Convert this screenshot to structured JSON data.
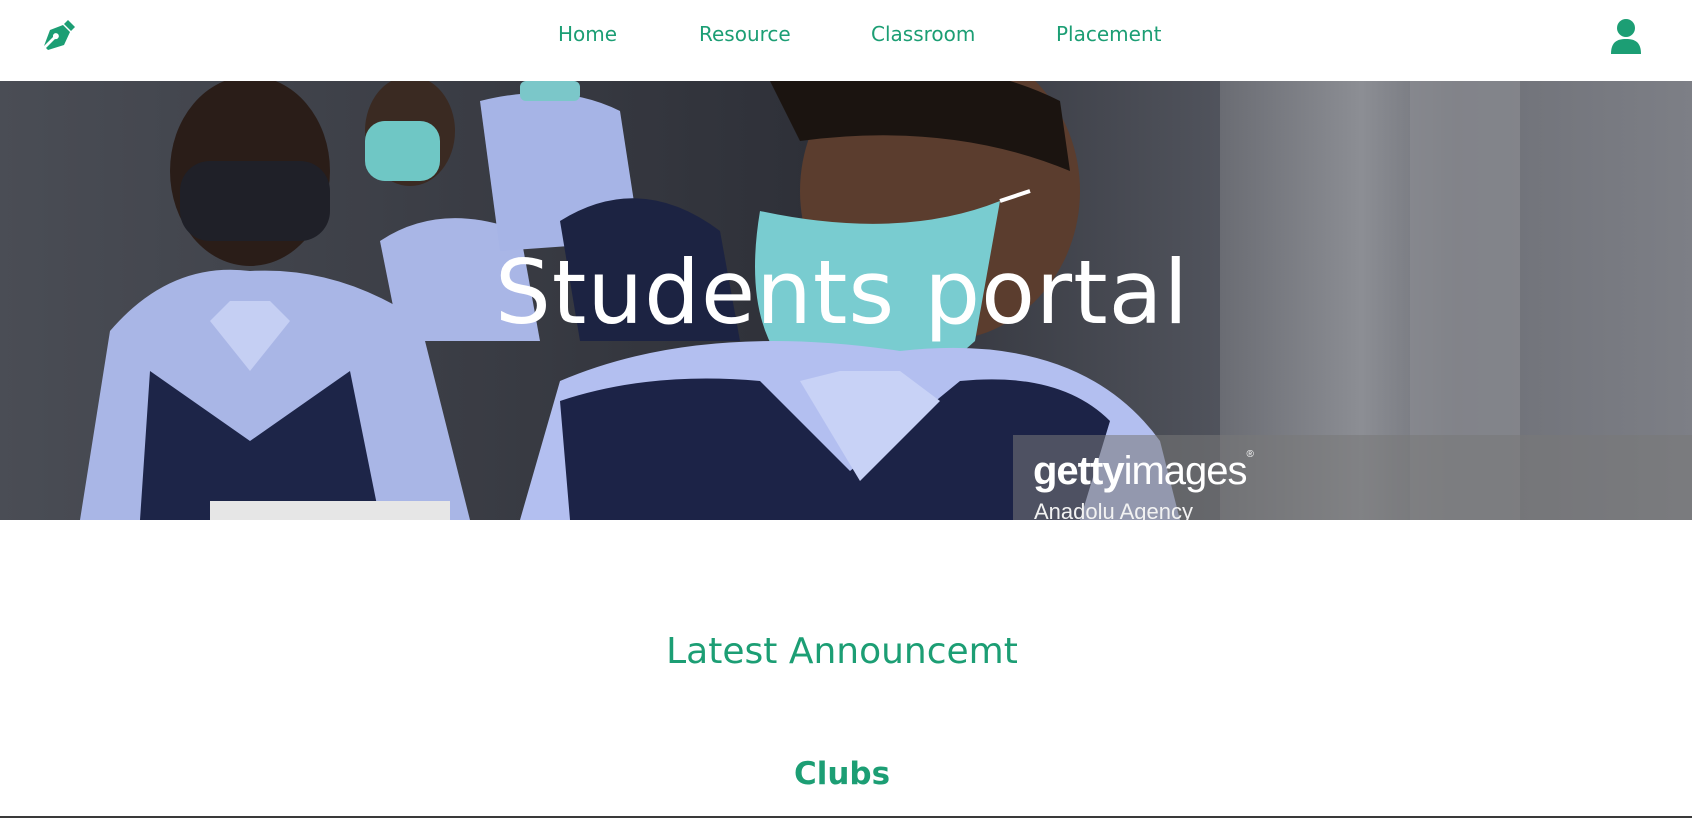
{
  "navbar": {
    "logo_icon": "pen-nib-icon",
    "links": [
      {
        "label": "Home"
      },
      {
        "label": "Resource"
      },
      {
        "label": "Classroom"
      },
      {
        "label": "Placement"
      }
    ],
    "user_icon": "user-icon"
  },
  "hero": {
    "title": "Students portal",
    "watermark": {
      "brand_bold": "getty",
      "brand_light": "images",
      "registered": "®",
      "credit": "Anadolu Agency"
    }
  },
  "sections": {
    "announcement_title": "Latest Announcemt",
    "clubs_title": "Clubs"
  },
  "colors": {
    "accent": "#1c9e74",
    "hero_text": "#ffffff"
  }
}
